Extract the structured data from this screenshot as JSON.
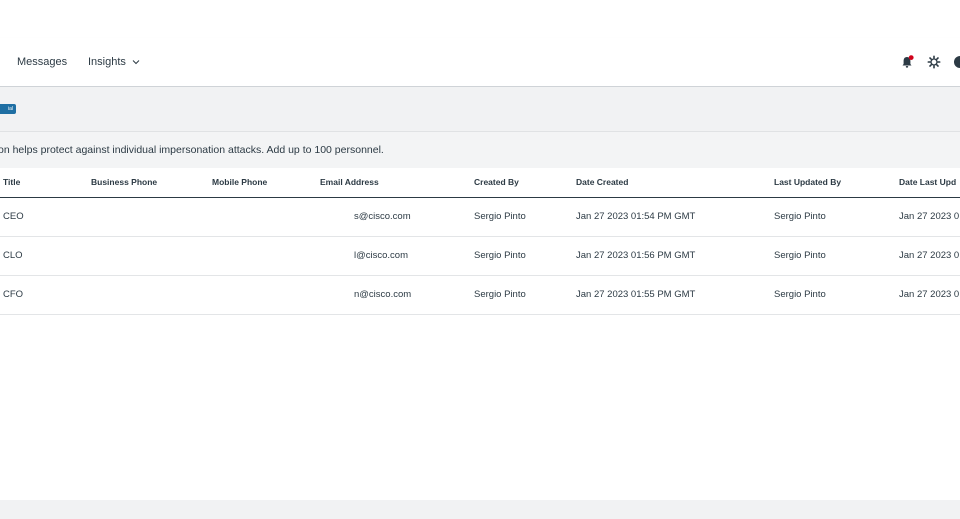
{
  "nav": {
    "messages_label": "Messages",
    "insights_label": "Insights",
    "icons": [
      "bell-icon",
      "gear-icon",
      "help-icon"
    ],
    "notification_dot_color": "#d0021b"
  },
  "badge": {
    "label": "ial"
  },
  "info": {
    "text": "on helps protect against individual impersonation attacks. Add up to 100 personnel."
  },
  "table": {
    "headers": {
      "title": "Title",
      "business_phone": "Business Phone",
      "mobile_phone": "Mobile Phone",
      "email": "Email Address",
      "created_by": "Created By",
      "date_created": "Date Created",
      "last_updated_by": "Last Updated By",
      "date_last_updated": "Date Last Upd"
    },
    "rows": [
      {
        "title": "CEO",
        "business_phone": "",
        "mobile_phone": "",
        "email": "s@cisco.com",
        "created_by": "Sergio Pinto",
        "date_created": "Jan 27 2023 01:54 PM GMT",
        "last_updated_by": "Sergio Pinto",
        "date_last_updated": "Jan 27 2023 0"
      },
      {
        "title": "CLO",
        "business_phone": "",
        "mobile_phone": "",
        "email": "l@cisco.com",
        "created_by": "Sergio Pinto",
        "date_created": "Jan 27 2023 01:56 PM GMT",
        "last_updated_by": "Sergio Pinto",
        "date_last_updated": "Jan 27 2023 0"
      },
      {
        "title": "CFO",
        "business_phone": "",
        "mobile_phone": "",
        "email": "n@cisco.com",
        "created_by": "Sergio Pinto",
        "date_created": "Jan 27 2023 01:55 PM GMT",
        "last_updated_by": "Sergio Pinto",
        "date_last_updated": "Jan 27 2023 0"
      }
    ]
  }
}
